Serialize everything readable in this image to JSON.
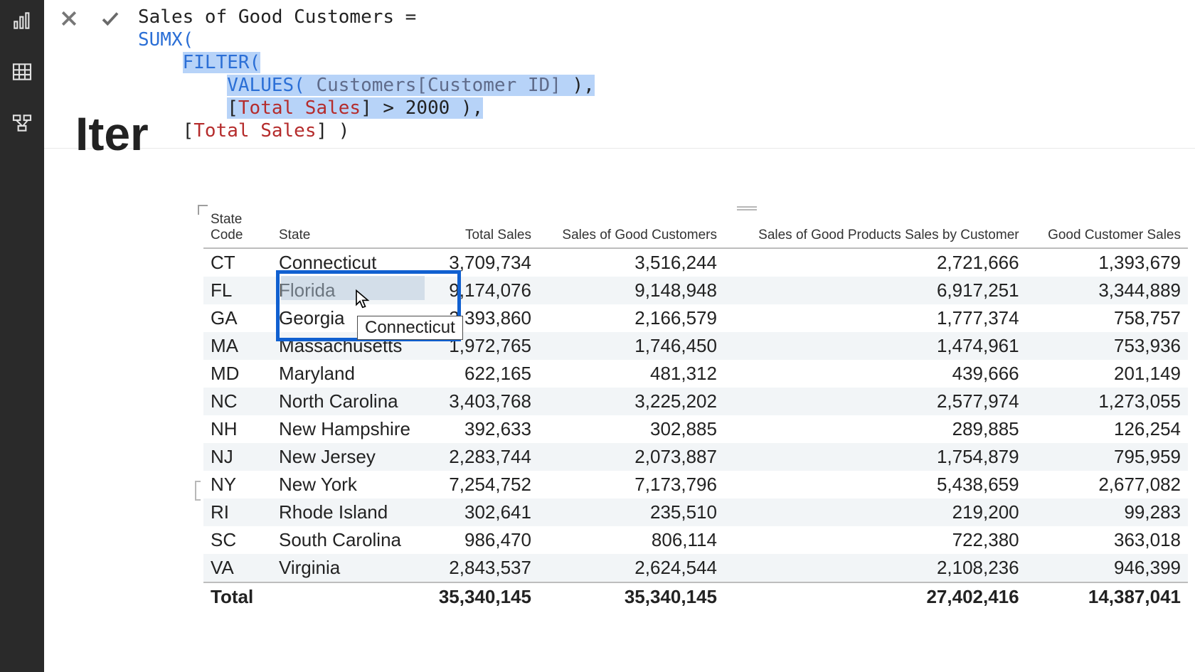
{
  "heading_partial": "Iter",
  "formula": {
    "line1_name": "Sales of Good Customers =",
    "sumx": "SUMX(",
    "filter": "FILTER(",
    "values_open": "VALUES( ",
    "values_col": "Customers[Customer ID]",
    "values_close": " ),",
    "cond_open": "[",
    "cond_measure": "Total Sales",
    "cond_close": "] > 2000 ),",
    "last_open": "[",
    "last_measure": "Total Sales",
    "last_close": "] )"
  },
  "tooltip": "Connecticut",
  "columns": [
    "State Code",
    "State",
    "Total Sales",
    "Sales of Good Customers",
    "Sales of Good Products Sales by Customer",
    "Good Customer Sales"
  ],
  "rows": [
    {
      "code": "CT",
      "state": "Connecticut",
      "c3": "3,709,734",
      "c4": "3,516,244",
      "c5": "2,721,666",
      "c6": "1,393,679"
    },
    {
      "code": "FL",
      "state": "Florida",
      "c3": "9,174,076",
      "c4": "9,148,948",
      "c5": "6,917,251",
      "c6": "3,344,889"
    },
    {
      "code": "GA",
      "state": "Georgia",
      "c3": "2,393,860",
      "c4": "2,166,579",
      "c5": "1,777,374",
      "c6": "758,757"
    },
    {
      "code": "MA",
      "state": "Massachusetts",
      "c3": "1,972,765",
      "c4": "1,746,450",
      "c5": "1,474,961",
      "c6": "753,936"
    },
    {
      "code": "MD",
      "state": "Maryland",
      "c3": "622,165",
      "c4": "481,312",
      "c5": "439,666",
      "c6": "201,149"
    },
    {
      "code": "NC",
      "state": "North Carolina",
      "c3": "3,403,768",
      "c4": "3,225,202",
      "c5": "2,577,974",
      "c6": "1,273,055"
    },
    {
      "code": "NH",
      "state": "New Hampshire",
      "c3": "392,633",
      "c4": "302,885",
      "c5": "289,885",
      "c6": "126,254"
    },
    {
      "code": "NJ",
      "state": "New Jersey",
      "c3": "2,283,744",
      "c4": "2,073,887",
      "c5": "1,754,879",
      "c6": "795,959"
    },
    {
      "code": "NY",
      "state": "New York",
      "c3": "7,254,752",
      "c4": "7,173,796",
      "c5": "5,438,659",
      "c6": "2,677,082"
    },
    {
      "code": "RI",
      "state": "Rhode Island",
      "c3": "302,641",
      "c4": "235,510",
      "c5": "219,200",
      "c6": "99,283"
    },
    {
      "code": "SC",
      "state": "South Carolina",
      "c3": "986,470",
      "c4": "806,114",
      "c5": "722,380",
      "c6": "363,018"
    },
    {
      "code": "VA",
      "state": "Virginia",
      "c3": "2,843,537",
      "c4": "2,624,544",
      "c5": "2,108,236",
      "c6": "946,399"
    }
  ],
  "total": {
    "label": "Total",
    "c3": "35,340,145",
    "c4": "35,340,145",
    "c5": "27,402,416",
    "c6": "14,387,041"
  }
}
